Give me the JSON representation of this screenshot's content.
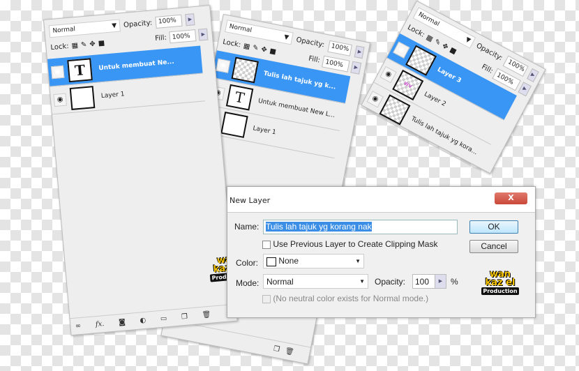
{
  "panel_back": {
    "blend_mode": "Normal",
    "lock_label": "Lock:",
    "opacity_label": "Opacity:",
    "opacity": "100%",
    "fill_label": "Fill:",
    "fill": "100%",
    "layers": [
      {
        "name": "Tulis lah tajuk yg k...",
        "thumb": "",
        "active": true
      },
      {
        "name": "Untuk membuat New L...",
        "thumb": "T",
        "active": false
      },
      {
        "name": "Layer 1",
        "thumb": "",
        "active": false
      }
    ]
  },
  "panel_right": {
    "blend_mode": "Normal",
    "lock_label": "Lock:",
    "opacity_label": "Opacity:",
    "opacity": "100%",
    "fill_label": "Fill:",
    "fill": "100%",
    "layers": [
      {
        "name": "Layer 3",
        "thumb": "",
        "active": true
      },
      {
        "name": "Layer 2",
        "thumb": "wv",
        "active": false
      },
      {
        "name": "Tulis lah tajuk yg kora...",
        "thumb": "",
        "active": false
      }
    ]
  },
  "panel_front": {
    "blend_mode": "Normal",
    "lock_label": "Lock:",
    "opacity_label": "Opacity:",
    "opacity": "100%",
    "fill_label": "Fill:",
    "fill": "100%",
    "layers": [
      {
        "name": "Untuk membuat Ne...",
        "thumb": "T",
        "active": true
      },
      {
        "name": "Layer 1",
        "thumb": "",
        "active": false
      }
    ],
    "toolbar_icons": [
      "link-icon",
      "fx-icon",
      "mask-icon",
      "adjustment-icon",
      "folder-icon",
      "new-layer-icon",
      "trash-icon"
    ],
    "fx_label": "fx."
  },
  "logo": {
    "line1": "wan",
    "line2": "kaz el",
    "line3": "Production"
  },
  "dialog": {
    "title": "New Layer",
    "close_label": "X",
    "name_label": "Name:",
    "name_value": "Tulis lah tajuk yg korang nak",
    "clipping_label": "Use Previous Layer to Create Clipping Mask",
    "color_label": "Color:",
    "color_value": "None",
    "mode_label": "Mode:",
    "mode_value": "Normal",
    "opacity_label": "Opacity:",
    "opacity_value": "100",
    "percent": "%",
    "neutral_label": "(No neutral color exists for Normal mode.)",
    "ok_label": "OK",
    "cancel_label": "Cancel"
  },
  "colors": {
    "selection": "#3a96f4",
    "logo_yellow": "#f6c400",
    "close_red": "#c9483a"
  }
}
